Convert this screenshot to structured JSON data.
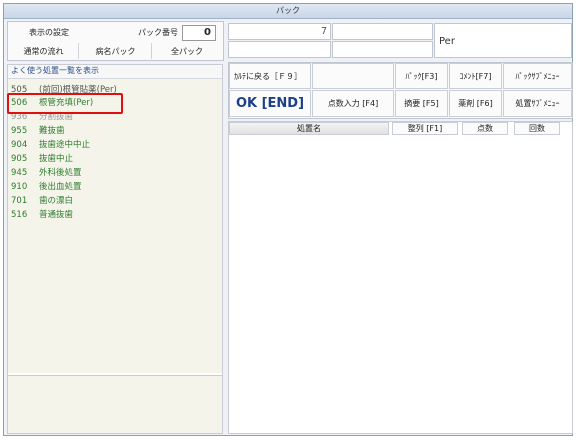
{
  "window": {
    "title": "パック"
  },
  "top_left": {
    "display_settings": "表示の設定",
    "pack_number_label": "パック番号",
    "pack_number_value": "0",
    "normal_flow": "通常の流れ",
    "disease_pack": "病名パック",
    "all_pack": "全パック"
  },
  "top_right": {
    "field1_value": "7",
    "per_label": "Per"
  },
  "list": {
    "header": "よく使う処置一覧を表示",
    "items": [
      {
        "code": "505",
        "label": "(前回)根管貼薬(Per)"
      },
      {
        "code": "506",
        "label": "根管充填(Per)"
      },
      {
        "code": "936",
        "label": "分割抜歯"
      },
      {
        "code": "955",
        "label": "難抜歯"
      },
      {
        "code": "904",
        "label": "抜歯途中中止"
      },
      {
        "code": "905",
        "label": "抜歯中止"
      },
      {
        "code": "945",
        "label": "外科後処置"
      },
      {
        "code": "910",
        "label": "後出血処置"
      },
      {
        "code": "701",
        "label": "歯の漂白"
      },
      {
        "code": "516",
        "label": "普通抜歯"
      }
    ]
  },
  "toolbar": {
    "back": "ｶﾙﾃに戻る［Ｆ９］",
    "pack_f3": "ﾊﾟｯｸ[F3]",
    "comment_f7": "ｺﾒﾝﾄ[F7]",
    "pack_submenu": "ﾊﾟｯｸｻﾌﾞﾒﾆｭｰ",
    "ok_end": "OK [END]",
    "points_input": "点数入力 [F4]",
    "summary": "摘要 [F5]",
    "drug": "薬剤 [F6]",
    "treatment_submenu": "処置ｻﾌﾞﾒﾆｭｰ"
  },
  "table": {
    "col_name": "処置名",
    "sort": "整列 [F1]",
    "col_points": "点数",
    "col_count": "回数"
  }
}
